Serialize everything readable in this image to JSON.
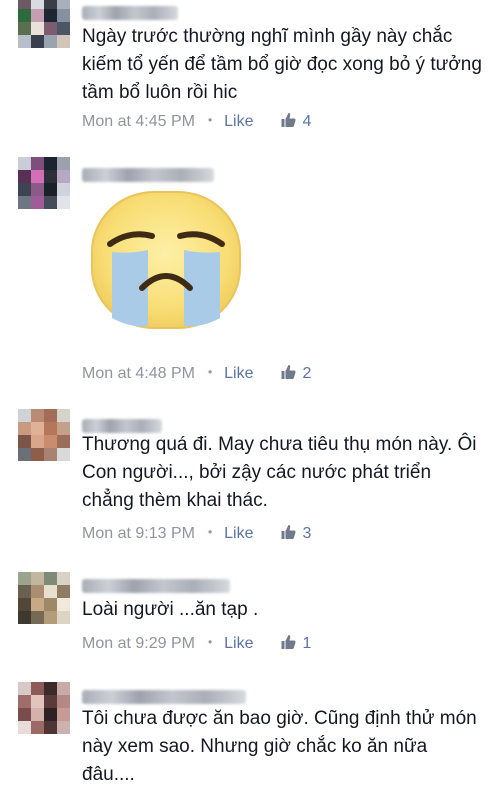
{
  "comments": [
    {
      "text": "Ngày trước thường nghĩ mình gầy này chắc kiếm tổ yến để tầm bổ giờ đọc xong bỏ ý tưởng tầm bổ luôn rồi hic",
      "time": "Mon at 4:45 PM",
      "like_label": "Like",
      "likes": "4",
      "avatar_colors": [
        "#6b5a64",
        "#d9dbe1",
        "#3a3f47",
        "#a8b0bc",
        "#2e6b3c",
        "#c59fb1",
        "#1f2633",
        "#8790a0",
        "#5a6f52",
        "#e8e2d8",
        "#7c5c6e",
        "#4b5666",
        "#b8bfca",
        "#393f4d",
        "#9aa3b0",
        "#d2c4b8"
      ]
    },
    {
      "sticker": "crying-face-sticker",
      "time": "Mon at 4:48 PM",
      "like_label": "Like",
      "likes": "2",
      "avatar_colors": [
        "#c8cdd6",
        "#7e4f7b",
        "#1d2430",
        "#9aa2b0",
        "#5a2f55",
        "#d36fb6",
        "#2a2f3a",
        "#b7a6c4",
        "#3c4452",
        "#8b5a86",
        "#1b2029",
        "#cfd4dc",
        "#6e7684",
        "#a05c97",
        "#444b59",
        "#e1e4e9"
      ]
    },
    {
      "text": "Thương quá đi. May chưa tiêu thụ món này. Ôi Con người..., bởi zậy các nước phát triển chẳng thèm khai thác.",
      "time": "Mon at 9:13 PM",
      "like_label": "Like",
      "likes": "3",
      "avatar_colors": [
        "#cfd2d6",
        "#b98b74",
        "#a36d58",
        "#d8d2cc",
        "#c99a80",
        "#e0b197",
        "#b6765c",
        "#c4a08c",
        "#7a5548",
        "#d7a68b",
        "#c88c6f",
        "#9b6e5c",
        "#6c7076",
        "#8f5e4b",
        "#a98371",
        "#d9d9d9"
      ]
    },
    {
      "text": "Loài người ...ăn tạp .",
      "time": "Mon at 9:29 PM",
      "like_label": "Like",
      "likes": "1",
      "avatar_colors": [
        "#9aa48f",
        "#c2b79e",
        "#7d8a78",
        "#d9d3c5",
        "#6b6150",
        "#a98f6f",
        "#e7dfcf",
        "#8e7d63",
        "#514638",
        "#c7a983",
        "#9d8868",
        "#f0e9dc",
        "#3f382f",
        "#776a55",
        "#b39c7a",
        "#dcd5c6"
      ]
    },
    {
      "text": "Tôi chưa được ăn bao giờ. Cũng định thử món này xem sao. Nhưng giờ chắc ko ăn nữa đâu....",
      "avatar_colors": [
        "#d8c9c6",
        "#8c5a58",
        "#3b2a2a",
        "#c9aaa6",
        "#a06e6a",
        "#e3c3bd",
        "#5a3b3a",
        "#b48884",
        "#7a4d4c",
        "#d5b1ab",
        "#2c2223",
        "#c79b95",
        "#e9dbd8",
        "#9b6966",
        "#4f3534",
        "#cbb2ae"
      ]
    }
  ]
}
